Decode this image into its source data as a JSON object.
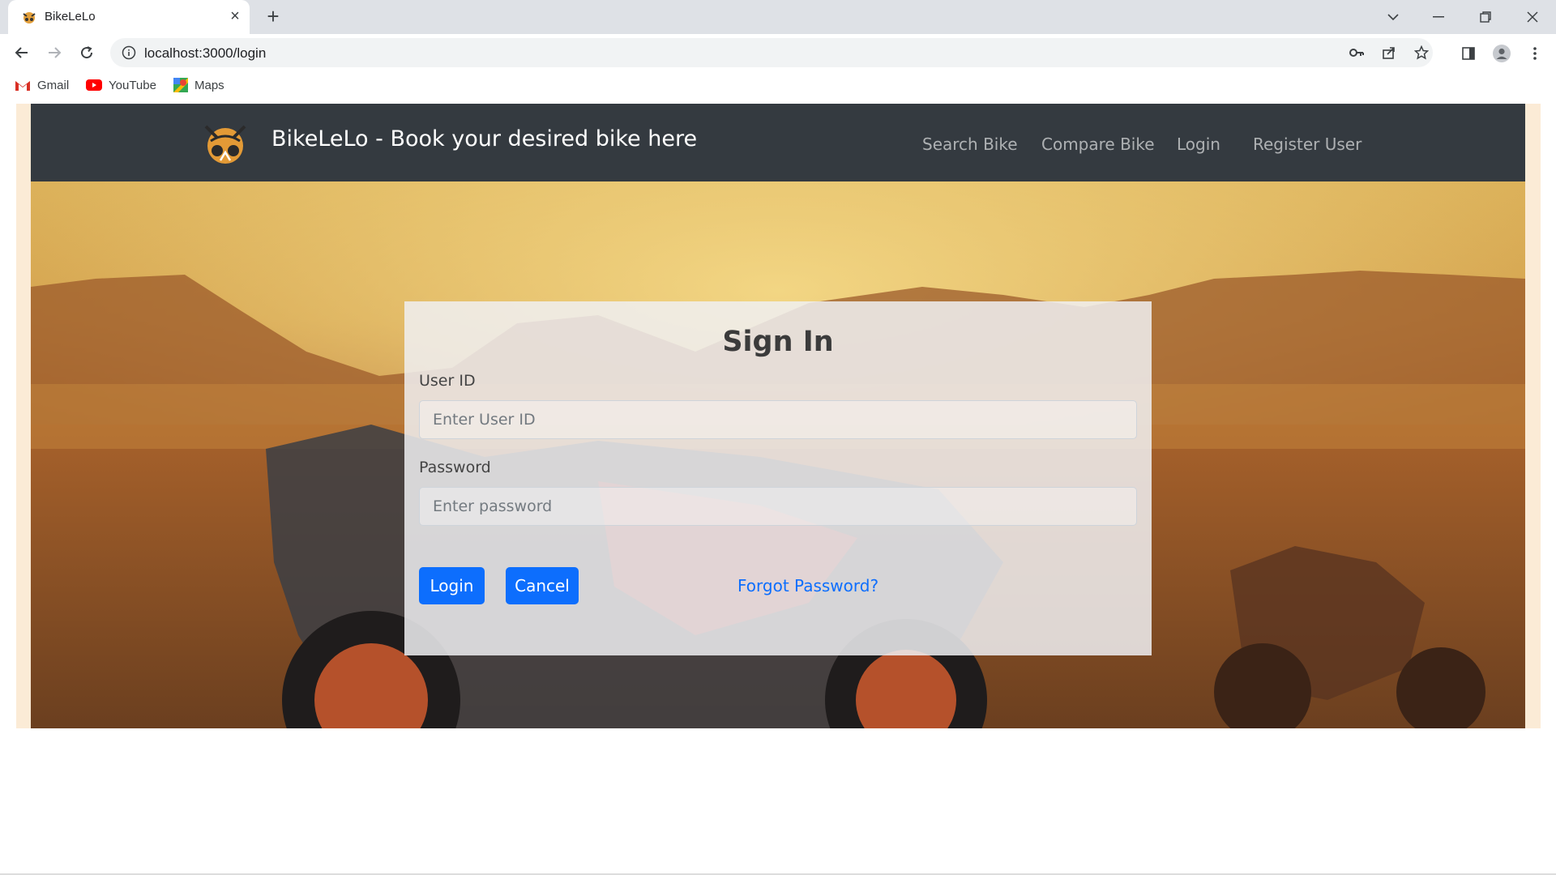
{
  "browser": {
    "tab_title": "BikeLeLo",
    "url": "localhost:3000/login",
    "bookmarks": [
      {
        "label": "Gmail",
        "icon": "gmail-icon"
      },
      {
        "label": "YouTube",
        "icon": "youtube-icon"
      },
      {
        "label": "Maps",
        "icon": "maps-icon"
      }
    ]
  },
  "navbar": {
    "brand": "BikeLeLo - Book your desired bike here",
    "links": [
      "Search Bike",
      "Compare Bike",
      "Login",
      "Register User"
    ],
    "background": "#343a40"
  },
  "login_form": {
    "title": "Sign In",
    "user_id_label": "User ID",
    "user_id_placeholder": "Enter User ID",
    "password_label": "Password",
    "password_placeholder": "Enter password",
    "login_button": "Login",
    "cancel_button": "Cancel",
    "forgot_link": "Forgot Password?",
    "accent": "#0d6efd"
  }
}
